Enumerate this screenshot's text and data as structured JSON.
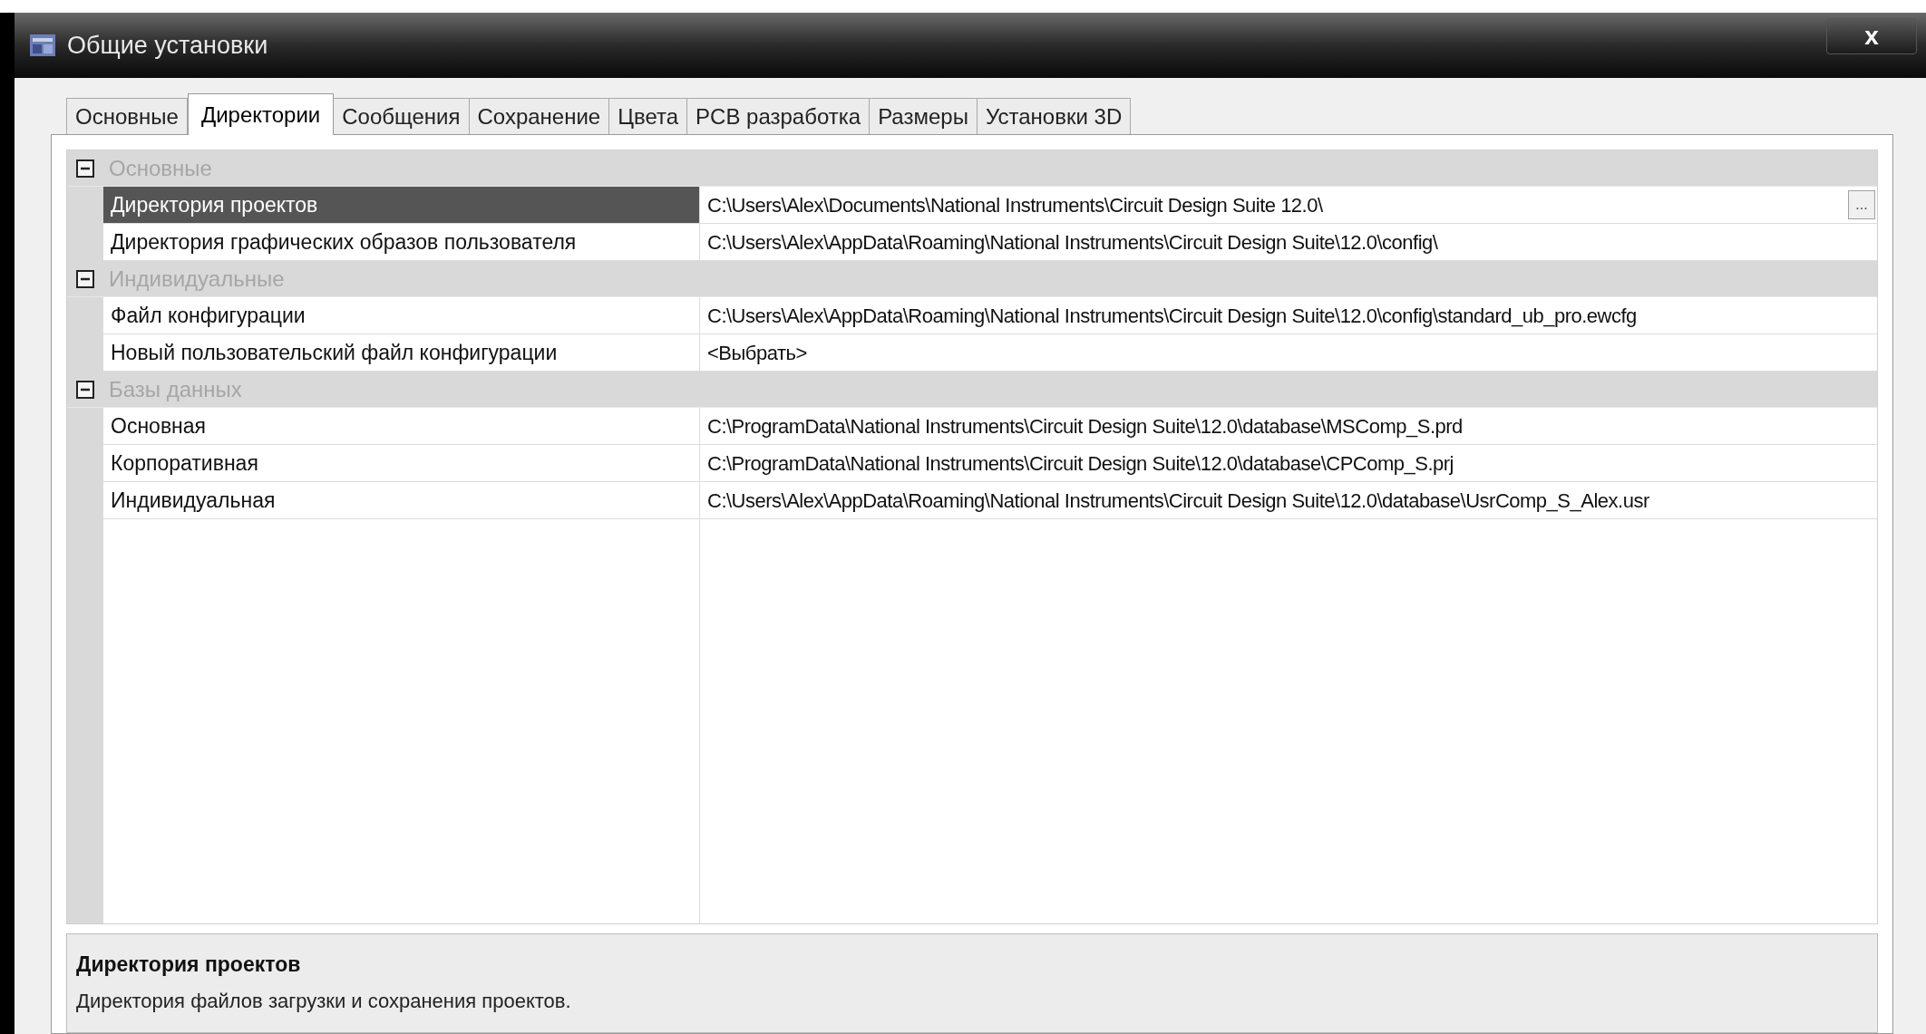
{
  "window": {
    "title": "Общие установки",
    "close": "x"
  },
  "tabs": [
    {
      "label": "Основные",
      "selected": false
    },
    {
      "label": "Директории",
      "selected": true
    },
    {
      "label": "Сообщения",
      "selected": false
    },
    {
      "label": "Сохранение",
      "selected": false
    },
    {
      "label": "Цвета",
      "selected": false
    },
    {
      "label": "PCB разработка",
      "selected": false
    },
    {
      "label": "Размеры",
      "selected": false
    },
    {
      "label": "Установки 3D",
      "selected": false
    }
  ],
  "property_grid": {
    "categories": [
      {
        "label": "Основные",
        "expanded": true,
        "items": [
          {
            "name": "Директория проектов",
            "value": "C:\\Users\\Alex\\Documents\\National Instruments\\Circuit Design Suite 12.0\\",
            "selected": true,
            "browse": "..."
          },
          {
            "name": "Директория графических образов пользователя",
            "value": "C:\\Users\\Alex\\AppData\\Roaming\\National Instruments\\Circuit Design Suite\\12.0\\config\\",
            "selected": false
          }
        ]
      },
      {
        "label": "Индивидуальные",
        "expanded": true,
        "items": [
          {
            "name": "Файл конфигурации",
            "value": "C:\\Users\\Alex\\AppData\\Roaming\\National Instruments\\Circuit Design Suite\\12.0\\config\\standard_ub_pro.ewcfg",
            "selected": false
          },
          {
            "name": "Новый пользовательский файл конфигурации",
            "value": "<Выбрать>",
            "selected": false
          }
        ]
      },
      {
        "label": "Базы данных",
        "expanded": true,
        "items": [
          {
            "name": "Основная",
            "value": "C:\\ProgramData\\National Instruments\\Circuit Design Suite\\12.0\\database\\MSComp_S.prd",
            "selected": false
          },
          {
            "name": "Корпоративная",
            "value": "C:\\ProgramData\\National Instruments\\Circuit Design Suite\\12.0\\database\\CPComp_S.prj",
            "selected": false
          },
          {
            "name": "Индивидуальная",
            "value": "C:\\Users\\Alex\\AppData\\Roaming\\National Instruments\\Circuit Design Suite\\12.0\\database\\UsrComp_S_Alex.usr",
            "selected": false
          }
        ]
      }
    ]
  },
  "description": {
    "title": "Директория проектов",
    "text": "Директория файлов загрузки и сохранения проектов."
  }
}
